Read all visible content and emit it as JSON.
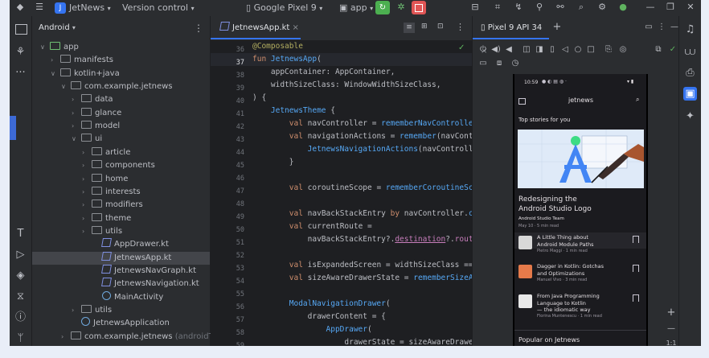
{
  "titlebar": {
    "project_badge": "J",
    "project_name": "JetNews",
    "vcs": "Version control",
    "device": "Google Pixel 9",
    "run_config": "app"
  },
  "project_panel": {
    "title": "Android",
    "tree": [
      {
        "label": "app",
        "depth": 0,
        "kind": "module",
        "expanded": true
      },
      {
        "label": "manifests",
        "depth": 1,
        "kind": "folder",
        "expanded": false
      },
      {
        "label": "kotlin+java",
        "depth": 1,
        "kind": "folder",
        "expanded": true
      },
      {
        "label": "com.example.jetnews",
        "depth": 2,
        "kind": "package",
        "expanded": true
      },
      {
        "label": "data",
        "depth": 3,
        "kind": "package",
        "expanded": false
      },
      {
        "label": "glance",
        "depth": 3,
        "kind": "package",
        "expanded": false
      },
      {
        "label": "model",
        "depth": 3,
        "kind": "package",
        "expanded": false
      },
      {
        "label": "ui",
        "depth": 3,
        "kind": "package",
        "expanded": true
      },
      {
        "label": "article",
        "depth": 4,
        "kind": "package",
        "expanded": false
      },
      {
        "label": "components",
        "depth": 4,
        "kind": "package",
        "expanded": false
      },
      {
        "label": "home",
        "depth": 4,
        "kind": "package",
        "expanded": false
      },
      {
        "label": "interests",
        "depth": 4,
        "kind": "package",
        "expanded": false
      },
      {
        "label": "modifiers",
        "depth": 4,
        "kind": "package",
        "expanded": false
      },
      {
        "label": "theme",
        "depth": 4,
        "kind": "package",
        "expanded": false
      },
      {
        "label": "utils",
        "depth": 4,
        "kind": "package",
        "expanded": false
      },
      {
        "label": "AppDrawer.kt",
        "depth": 5,
        "kind": "kt"
      },
      {
        "label": "JetnewsApp.kt",
        "depth": 5,
        "kind": "kt",
        "selected": true
      },
      {
        "label": "JetnewsNavGraph.kt",
        "depth": 5,
        "kind": "kt"
      },
      {
        "label": "JetnewsNavigation.kt",
        "depth": 5,
        "kind": "kt"
      },
      {
        "label": "MainActivity",
        "depth": 5,
        "kind": "activity"
      },
      {
        "label": "utils",
        "depth": 3,
        "kind": "package",
        "expanded": false
      },
      {
        "label": "JetnewsApplication",
        "depth": 3,
        "kind": "activity"
      },
      {
        "label": "com.example.jetnews",
        "depth": 2,
        "kind": "package",
        "expanded": false,
        "suffix": "(androidTe"
      }
    ]
  },
  "editor": {
    "tab_label": "JetnewsApp.kt",
    "line_numbers": [
      "36",
      "37",
      "38",
      "39",
      "40",
      "41",
      "42",
      "43",
      "44",
      "45",
      "46",
      "47",
      "48",
      "49",
      "50",
      "51",
      "52",
      "53",
      "54",
      "55",
      "56",
      "57",
      "58",
      "59"
    ],
    "current_line": "37"
  },
  "devices": {
    "tab_label": "Pixel 9 API 34"
  },
  "phone": {
    "status_time": "10:59",
    "app_title": "jetnews",
    "top_stories": "Top stories for you",
    "featured_title_1": "Redesigning the",
    "featured_title_2": "Android Studio Logo",
    "featured_author": "Android Studio Team",
    "featured_meta": "May 10 · 5 min read",
    "posts": [
      {
        "title1": "A Little Thing about",
        "title2": "Android Module Paths",
        "meta": "Pietro Maggi · 1 min read",
        "color": "#d8d8d8"
      },
      {
        "title1": "Dagger in Kotlin: Gotchas",
        "title2": "and Optimizations",
        "meta": "Manuel Vivo · 3 min read",
        "color": "#e57a4a"
      },
      {
        "title1": "From Java Programming",
        "title2": "Language to Kotlin",
        "title3": "— the idiomatic way",
        "meta": "Florina Muntenescu · 1 min read",
        "color": "#e8e8e8"
      }
    ],
    "popular": "Popular on Jetnews"
  },
  "zoom": {
    "ratio": "1:1"
  },
  "colors": {
    "accent": "#3574f0",
    "run_green": "#4caf50",
    "stop_red": "#e05555"
  }
}
